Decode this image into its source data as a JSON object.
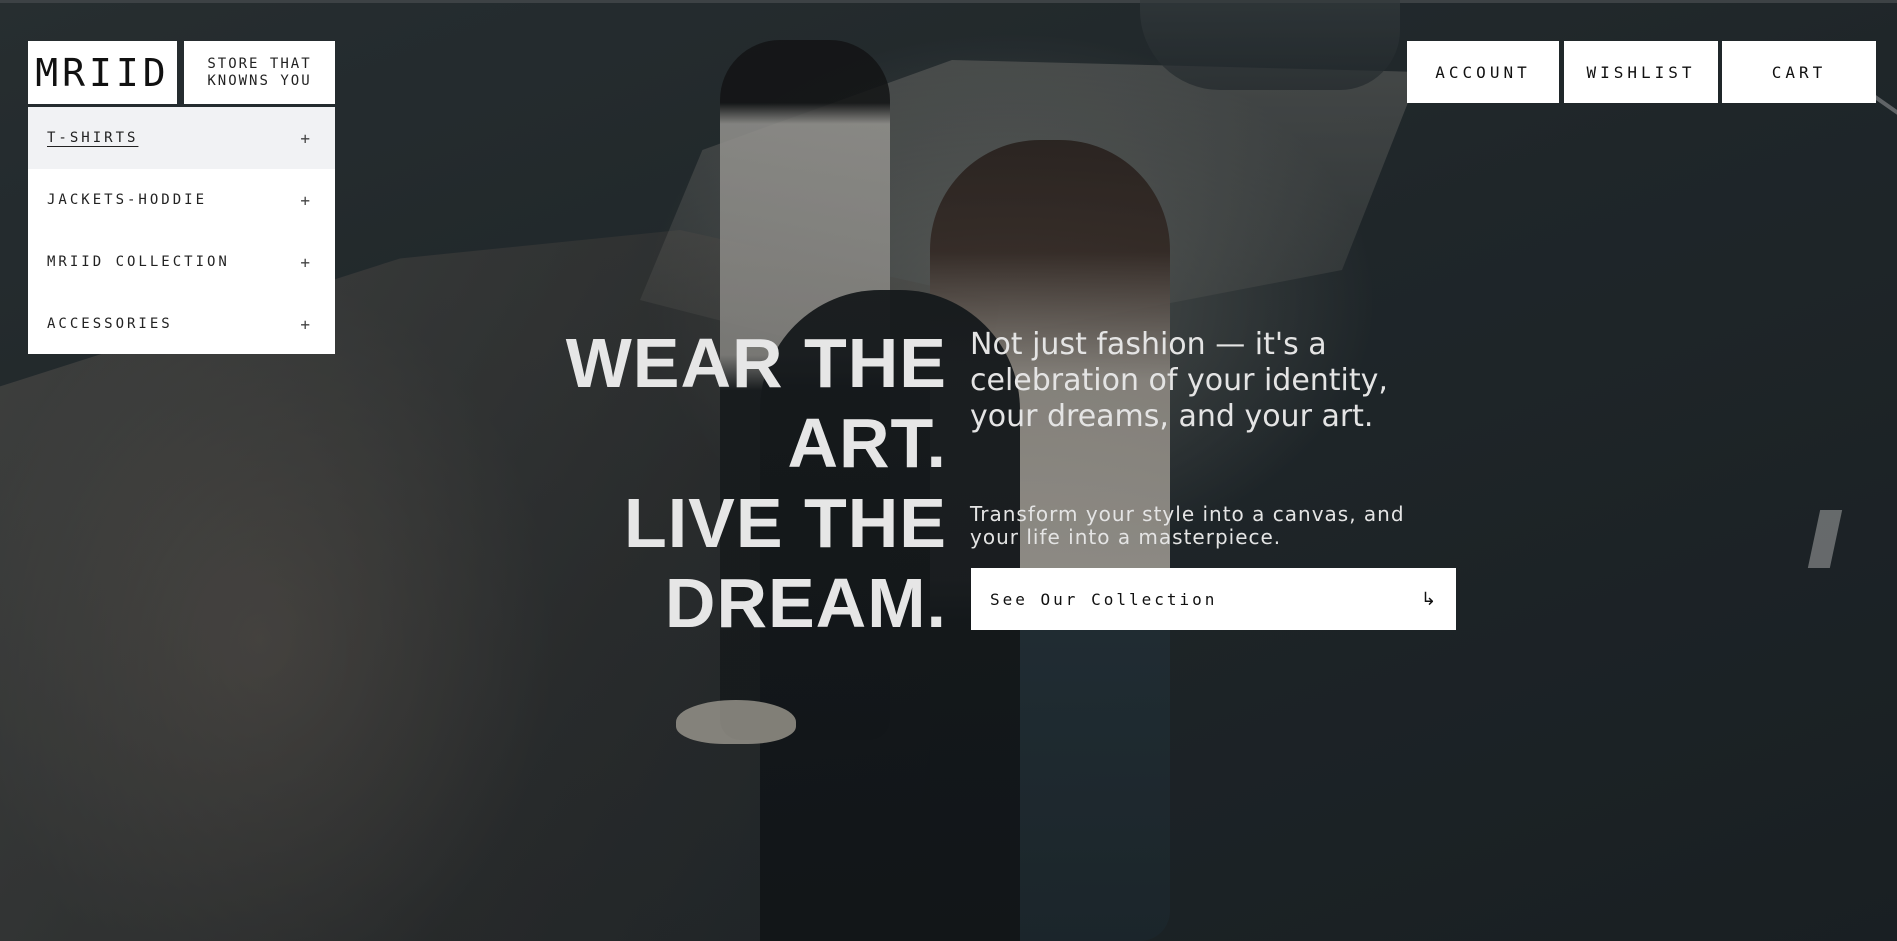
{
  "brand": {
    "logo": "MRIID",
    "tagline_line1": "STORE THAT",
    "tagline_line2": "KNOWNS YOU"
  },
  "menu": {
    "items": [
      {
        "label": "T-SHIRTS",
        "expand": "+"
      },
      {
        "label": "JACKETS-HODDIE",
        "expand": "+"
      },
      {
        "label": "MRIID COLLECTION",
        "expand": "+"
      },
      {
        "label": "ACCESSORIES",
        "expand": "+"
      }
    ]
  },
  "header": {
    "account": "ACCOUNT",
    "wishlist": "WISHLIST",
    "cart": "CART"
  },
  "hero": {
    "headline": [
      "WEAR THE",
      "ART.",
      "LIVE THE",
      "DREAM."
    ],
    "lead": "Not just fashion — it's a celebration of your identity, your dreams, and your art.",
    "sub": "Transform your style into a canvas, and your life into a masterpiece.",
    "cta_label": "See Our Collection",
    "cta_icon": "↳"
  }
}
